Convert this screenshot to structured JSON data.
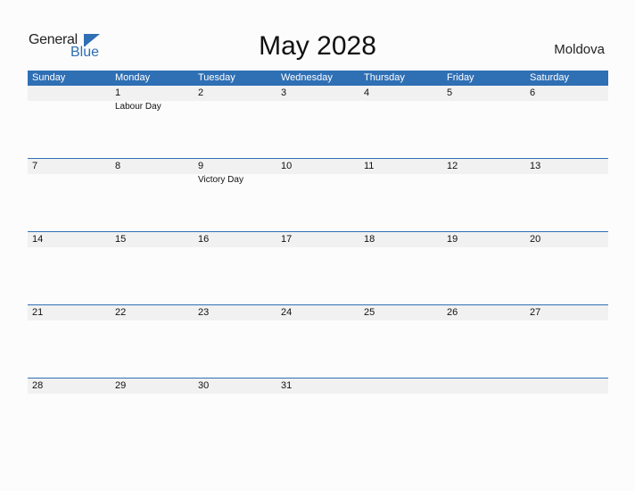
{
  "logo": {
    "general": "General",
    "blue": "Blue"
  },
  "title": "May 2028",
  "country": "Moldova",
  "colors": {
    "accent": "#2f6fb4",
    "row_bg": "#f1f1f1"
  },
  "days": [
    "Sunday",
    "Monday",
    "Tuesday",
    "Wednesday",
    "Thursday",
    "Friday",
    "Saturday"
  ],
  "weeks": [
    {
      "dates": [
        "",
        "1",
        "2",
        "3",
        "4",
        "5",
        "6"
      ],
      "events": [
        "",
        "Labour Day",
        "",
        "",
        "",
        "",
        ""
      ]
    },
    {
      "dates": [
        "7",
        "8",
        "9",
        "10",
        "11",
        "12",
        "13"
      ],
      "events": [
        "",
        "",
        "Victory Day",
        "",
        "",
        "",
        ""
      ]
    },
    {
      "dates": [
        "14",
        "15",
        "16",
        "17",
        "18",
        "19",
        "20"
      ],
      "events": [
        "",
        "",
        "",
        "",
        "",
        "",
        ""
      ]
    },
    {
      "dates": [
        "21",
        "22",
        "23",
        "24",
        "25",
        "26",
        "27"
      ],
      "events": [
        "",
        "",
        "",
        "",
        "",
        "",
        ""
      ]
    },
    {
      "dates": [
        "28",
        "29",
        "30",
        "31",
        "",
        "",
        ""
      ],
      "events": [
        "",
        "",
        "",
        "",
        "",
        "",
        ""
      ]
    }
  ]
}
